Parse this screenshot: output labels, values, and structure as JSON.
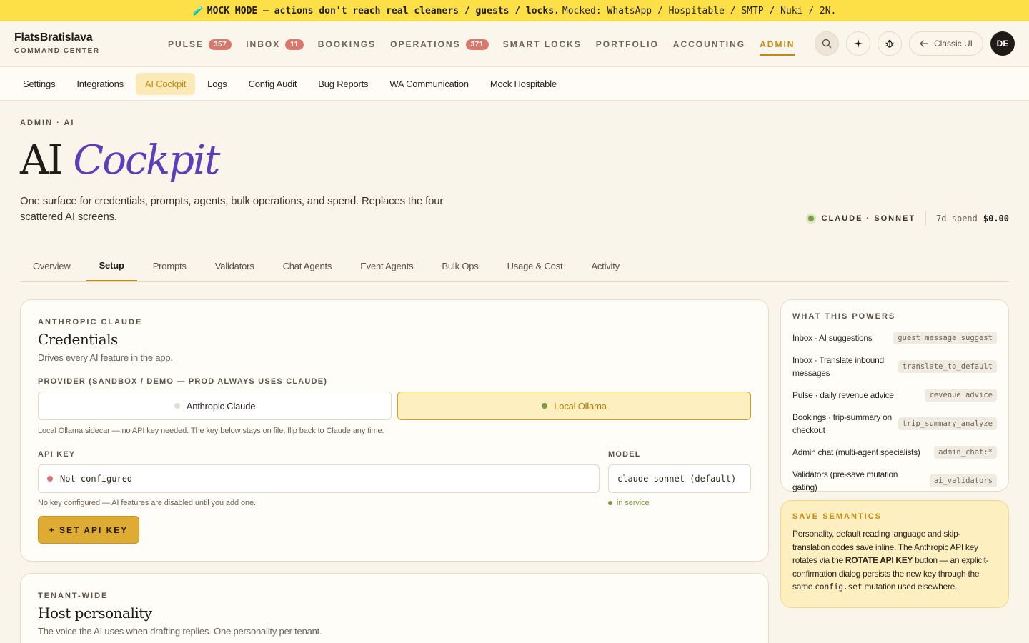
{
  "banner": {
    "icon": "🧪",
    "bold_text": "MOCK MODE — actions don't reach real cleaners / guests / locks.",
    "rest_text": "Mocked: WhatsApp / Hospitable / SMTP / Nuki / 2N."
  },
  "brand": {
    "name": "FlatsBratislava",
    "subtitle": "COMMAND CENTER"
  },
  "nav": {
    "items": [
      {
        "label": "PULSE",
        "badge": "357"
      },
      {
        "label": "INBOX",
        "badge": "11"
      },
      {
        "label": "BOOKINGS"
      },
      {
        "label": "OPERATIONS",
        "badge": "371"
      },
      {
        "label": "SMART LOCKS"
      },
      {
        "label": "PORTFOLIO"
      },
      {
        "label": "ACCOUNTING"
      },
      {
        "label": "ADMIN",
        "active": true
      }
    ],
    "classic_label": "Classic UI",
    "avatar_initials": "DE"
  },
  "subnav": {
    "items": [
      "Settings",
      "Integrations",
      "AI Cockpit",
      "Logs",
      "Config Audit",
      "Bug Reports",
      "WA Communication",
      "Mock Hospitable"
    ],
    "active": "AI Cockpit"
  },
  "header": {
    "eyebrow": "ADMIN · AI",
    "title_plain": "AI",
    "title_accent": "Cockpit",
    "lede": "One surface for credentials, prompts, agents, bulk operations, and spend. Replaces the four scattered AI screens.",
    "model_label": "CLAUDE · SONNET",
    "spend_label": "7d spend",
    "spend_value": "$0.00"
  },
  "tabs": {
    "items": [
      "Overview",
      "Setup",
      "Prompts",
      "Validators",
      "Chat Agents",
      "Event Agents",
      "Bulk Ops",
      "Usage & Cost",
      "Activity"
    ],
    "active": "Setup"
  },
  "credentials": {
    "eyebrow": "ANTHROPIC CLAUDE",
    "title": "Credentials",
    "desc": "Drives every AI feature in the app.",
    "provider_label": "PROVIDER (SANDBOX / DEMO — PROD ALWAYS USES CLAUDE)",
    "provider_claude": "Anthropic Claude",
    "provider_ollama": "Local Ollama",
    "provider_hint": "Local Ollama sidecar — no API key needed. The key below stays on file; flip back to Claude any time.",
    "api_key_label": "API KEY",
    "api_key_value": "Not configured",
    "api_key_hint": "No key configured — AI features are disabled until you add one.",
    "model_label": "MODEL",
    "model_value": "claude-sonnet (default)",
    "model_status": "in service",
    "set_key_button": "+ SET API KEY"
  },
  "host": {
    "eyebrow": "TENANT-WIDE",
    "title": "Host personality",
    "desc": "The voice the AI uses when drafting replies. One personality per tenant."
  },
  "powers": {
    "title": "WHAT THIS POWERS",
    "rows": [
      {
        "label": "Inbox · AI suggestions",
        "code": "guest_message_suggest"
      },
      {
        "label": "Inbox · Translate inbound messages",
        "code": "translate_to_default"
      },
      {
        "label": "Pulse · daily revenue advice",
        "code": "revenue_advice"
      },
      {
        "label": "Bookings · trip-summary on checkout",
        "code": "trip_summary_analyze"
      },
      {
        "label": "Admin chat (multi-agent specialists)",
        "code": "admin_chat:*"
      },
      {
        "label": "Validators (pre-save mutation gating)",
        "code": "ai_validators"
      }
    ]
  },
  "save": {
    "title": "SAVE SEMANTICS",
    "part1": "Personality, default reading language and skip-translation codes save inline. The Anthropic API key rotates via the ",
    "bold": "ROTATE API KEY",
    "part2": " button — an explicit-confirmation dialog persists the new key through the same ",
    "code": "config.set",
    "part3": " mutation used elsewhere."
  },
  "colors": {
    "accent": "#c58a10",
    "purple": "#5b3fb8",
    "banner": "#fde047",
    "status_green": "#7c9a3d",
    "error_red": "#e0707a"
  }
}
